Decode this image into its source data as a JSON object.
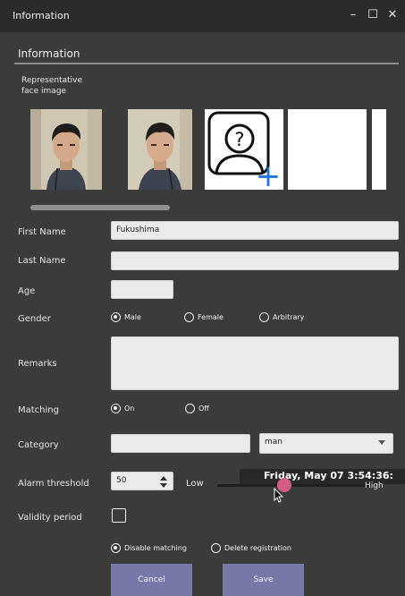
{
  "window": {
    "title": "Information",
    "minimize_label": "–",
    "maximize_label": "☐",
    "close_label": "✕"
  },
  "section": {
    "title": "Information"
  },
  "faces": {
    "label": "Representative\nface image",
    "add_placeholder_glyph": "?",
    "add_plus_glyph": "+"
  },
  "form": {
    "first_name": {
      "label": "First Name",
      "value": "Fukushima"
    },
    "last_name": {
      "label": "Last Name",
      "value": ""
    },
    "age": {
      "label": "Age",
      "value": ""
    },
    "gender": {
      "label": "Gender",
      "options": [
        "Male",
        "Female",
        "Arbitrary"
      ],
      "selected": "Male"
    },
    "remarks": {
      "label": "Remarks",
      "value": ""
    },
    "matching": {
      "label": "Matching",
      "options": [
        "On",
        "Off"
      ],
      "selected": "On"
    },
    "category": {
      "label": "Category",
      "text_value": "",
      "select_value": "man"
    },
    "alarm_threshold": {
      "label": "Alarm threshold",
      "value": "50",
      "low_label": "Low",
      "high_label": "High",
      "slider_level": 0.42
    },
    "validity_period": {
      "label": "Validity period",
      "checked": false,
      "options": [
        "Disable matching",
        "Delete registration"
      ],
      "selected": "Disable matching"
    }
  },
  "overlay": {
    "datetime": "Friday, May 07  3:54:36:"
  },
  "buttons": {
    "cancel": "Cancel",
    "save": "Save"
  },
  "colors": {
    "window_bg": "#3b3b3b",
    "titlebar_bg": "#2b2b2b",
    "button_bg": "#7678a8",
    "slider_thumb": "#d25c84",
    "add_icon_blue": "#1f75d8"
  }
}
